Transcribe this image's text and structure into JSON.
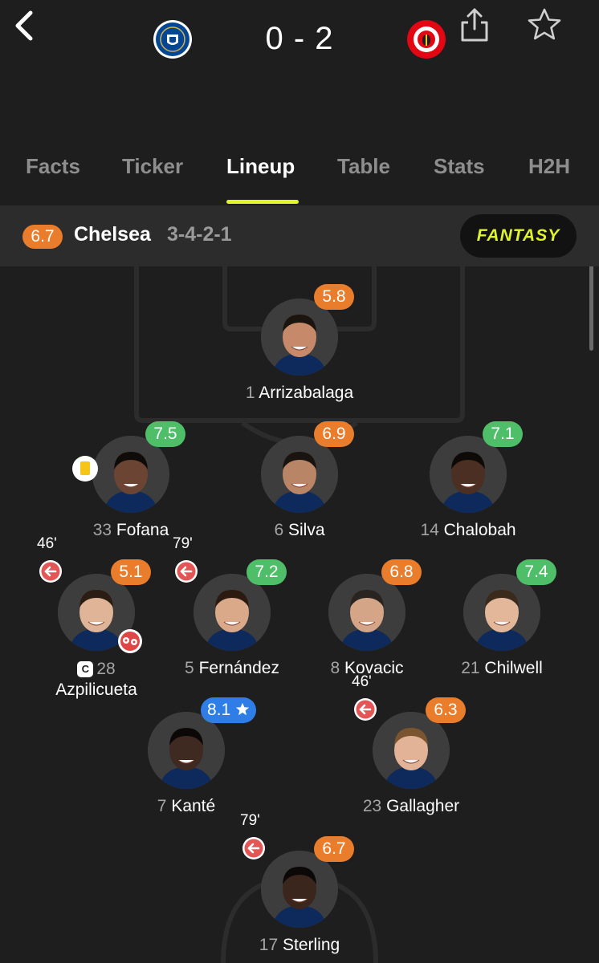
{
  "header": {
    "home_team_crest": "chelsea-crest-icon",
    "away_team_crest": "brentford-crest-icon",
    "score": "0 - 2"
  },
  "tabs": [
    {
      "label": "Facts",
      "active": false
    },
    {
      "label": "Ticker",
      "active": false
    },
    {
      "label": "Lineup",
      "active": true
    },
    {
      "label": "Table",
      "active": false
    },
    {
      "label": "Stats",
      "active": false
    },
    {
      "label": "H2H",
      "active": false
    }
  ],
  "team": {
    "rating": "6.7",
    "name": "Chelsea",
    "formation": "3-4-2-1",
    "fantasy_label": "FANTASY"
  },
  "colors": {
    "accent": "#dff52a",
    "rating_orange": "#e97d2c",
    "rating_green": "#4ebf68",
    "rating_blue": "#2f7ee8",
    "sub_red": "#e45555",
    "yellow_card": "#f5c518"
  },
  "players": [
    {
      "number": "1",
      "name": "Arrizabalaga",
      "rating": "5.8",
      "rating_color": "orange"
    },
    {
      "number": "33",
      "name": "Fofana",
      "rating": "7.5",
      "rating_color": "green",
      "yellow_card": true
    },
    {
      "number": "6",
      "name": "Silva",
      "rating": "6.9",
      "rating_color": "orange"
    },
    {
      "number": "14",
      "name": "Chalobah",
      "rating": "7.1",
      "rating_color": "green"
    },
    {
      "number": "28",
      "name": "Azpilicueta",
      "rating": "5.1",
      "rating_color": "orange",
      "sub_minute": "46'",
      "captain": "C",
      "own_goal": true
    },
    {
      "number": "5",
      "name": "Fernández",
      "rating": "7.2",
      "rating_color": "green",
      "sub_minute": "79'"
    },
    {
      "number": "8",
      "name": "Kovacic",
      "rating": "6.8",
      "rating_color": "orange"
    },
    {
      "number": "21",
      "name": "Chilwell",
      "rating": "7.4",
      "rating_color": "green"
    },
    {
      "number": "7",
      "name": "Kanté",
      "rating": "8.1",
      "rating_color": "blue",
      "player_of_match": true
    },
    {
      "number": "23",
      "name": "Gallagher",
      "rating": "6.3",
      "rating_color": "orange",
      "sub_minute": "46'"
    },
    {
      "number": "17",
      "name": "Sterling",
      "rating": "6.7",
      "rating_color": "orange",
      "sub_minute": "79'"
    }
  ]
}
